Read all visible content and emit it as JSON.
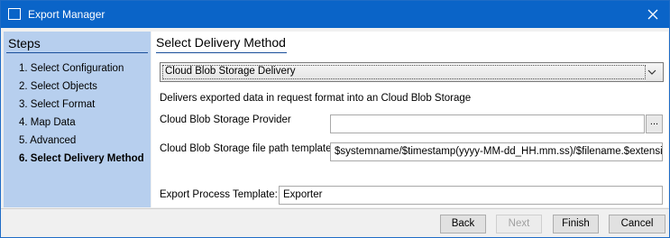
{
  "window": {
    "title": "Export Manager"
  },
  "sidebar": {
    "title": "Steps",
    "steps": [
      {
        "label": "1. Select Configuration"
      },
      {
        "label": "2. Select Objects"
      },
      {
        "label": "3. Select Format"
      },
      {
        "label": "4. Map Data"
      },
      {
        "label": "5. Advanced"
      },
      {
        "label": "6. Select Delivery Method"
      }
    ],
    "active_step": "6. Select Delivery Method"
  },
  "main": {
    "section_title": "Select Delivery Method",
    "delivery_select": {
      "value": "Cloud Blob Storage Delivery"
    },
    "description": "Delivers exported data in request format into an Cloud Blob Storage",
    "provider": {
      "label": "Cloud Blob Storage Provider",
      "value": "",
      "browse_label": "..."
    },
    "path_template": {
      "label": "Cloud Blob Storage file path template",
      "value": "$systemname/$timestamp(yyyy-MM-dd_HH.mm.ss)/$filename.$extension"
    },
    "process_template": {
      "label": "Export Process Template:",
      "value": "Exporter"
    }
  },
  "footer": {
    "back_label": "Back",
    "next_label": "Next",
    "finish_label": "Finish",
    "cancel_label": "Cancel"
  },
  "colors": {
    "titlebar": "#0a64c8",
    "sidebar": "#b7cfee",
    "accent_line": "#1a4f9a"
  }
}
